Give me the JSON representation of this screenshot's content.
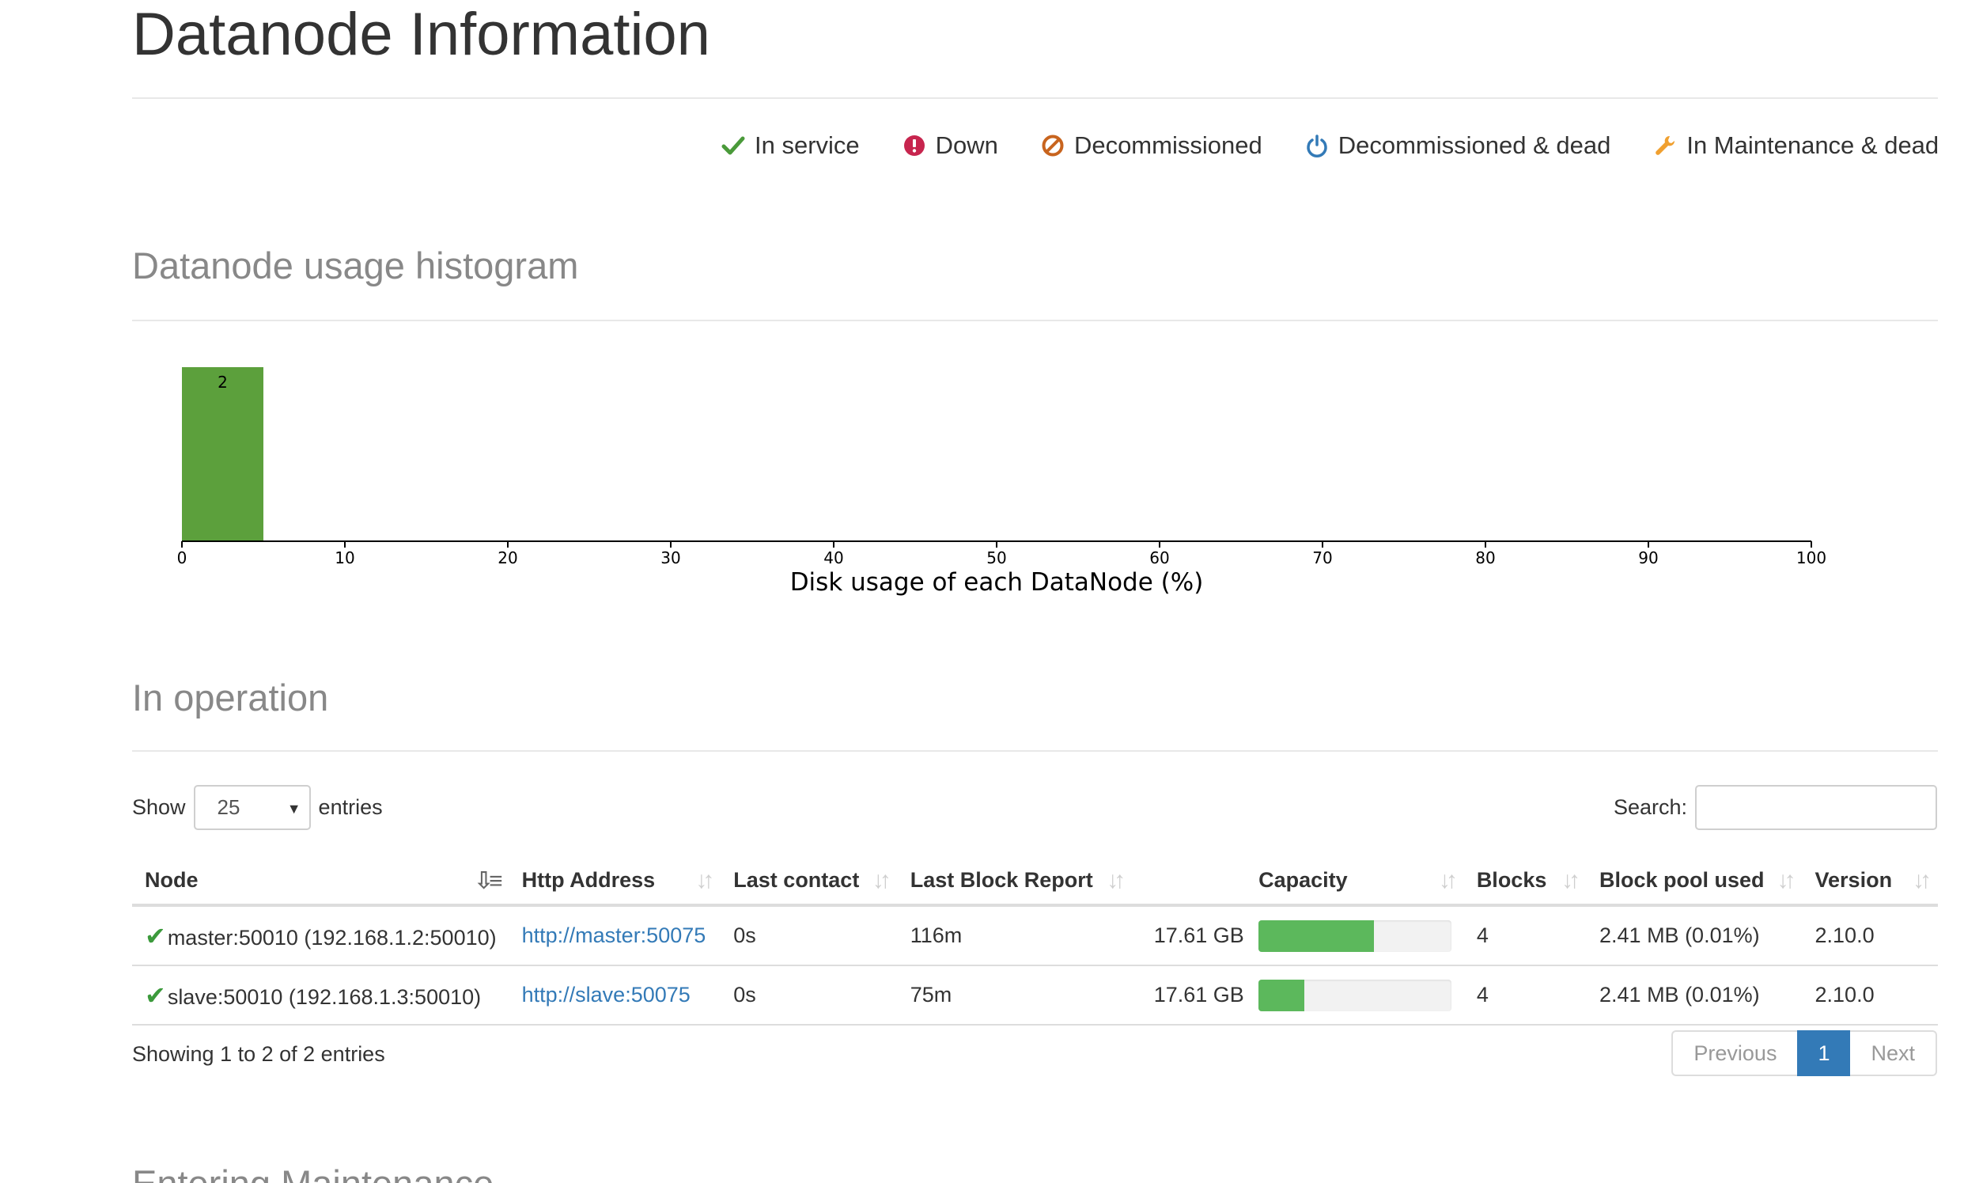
{
  "page": {
    "title": "Datanode Information"
  },
  "legend": [
    {
      "label": "In service",
      "icon": "check-icon",
      "color": "#4a9a3a"
    },
    {
      "label": "Down",
      "icon": "exclamation-circle-icon",
      "color": "#c7254e"
    },
    {
      "label": "Decommissioned",
      "icon": "ban-icon",
      "color": "#c8641e"
    },
    {
      "label": "Decommissioned & dead",
      "icon": "power-icon",
      "color": "#337ab7"
    },
    {
      "label": "In Maintenance & dead",
      "icon": "wrench-icon",
      "color": "#f0a030"
    }
  ],
  "histogram": {
    "heading": "Datanode usage histogram"
  },
  "chart_data": {
    "type": "bar",
    "title": "",
    "xlabel": "Disk usage of each DataNode (%)",
    "ylabel": "",
    "xlim": [
      0,
      100
    ],
    "x_ticks": [
      "0",
      "10",
      "20",
      "30",
      "40",
      "50",
      "60",
      "70",
      "80",
      "90",
      "100"
    ],
    "bins": [
      {
        "x0": 0,
        "x1": 5,
        "count": 2,
        "label": "2"
      }
    ],
    "bar_color": "#5ca03c",
    "grid": false
  },
  "operation": {
    "heading": "In operation",
    "show_label": "Show",
    "entries_label": "entries",
    "length_value": "25",
    "search_label": "Search:",
    "search_value": "",
    "columns": {
      "node": "Node",
      "http": "Http Address",
      "last_contact": "Last contact",
      "last_block_report": "Last Block Report",
      "capacity": "Capacity",
      "blocks": "Blocks",
      "block_pool_used": "Block pool used",
      "version": "Version"
    },
    "rows": [
      {
        "status_icon": "check-icon",
        "node": "master:50010 (192.168.1.2:50010)",
        "http": "http://master:50075",
        "last_contact": "0s",
        "last_block_report": "116m",
        "capacity": "17.61 GB",
        "capacity_used_fraction": 0.6,
        "blocks": "4",
        "block_pool_used": "2.41 MB (0.01%)",
        "version": "2.10.0"
      },
      {
        "status_icon": "check-icon",
        "node": "slave:50010 (192.168.1.3:50010)",
        "http": "http://slave:50075",
        "last_contact": "0s",
        "last_block_report": "75m",
        "capacity": "17.61 GB",
        "capacity_used_fraction": 0.24,
        "blocks": "4",
        "block_pool_used": "2.41 MB (0.01%)",
        "version": "2.10.0"
      }
    ],
    "info": "Showing 1 to 2 of 2 entries",
    "pagination": {
      "previous": "Previous",
      "current": "1",
      "next": "Next"
    }
  },
  "next_section": {
    "heading": "Entering Maintenance"
  }
}
